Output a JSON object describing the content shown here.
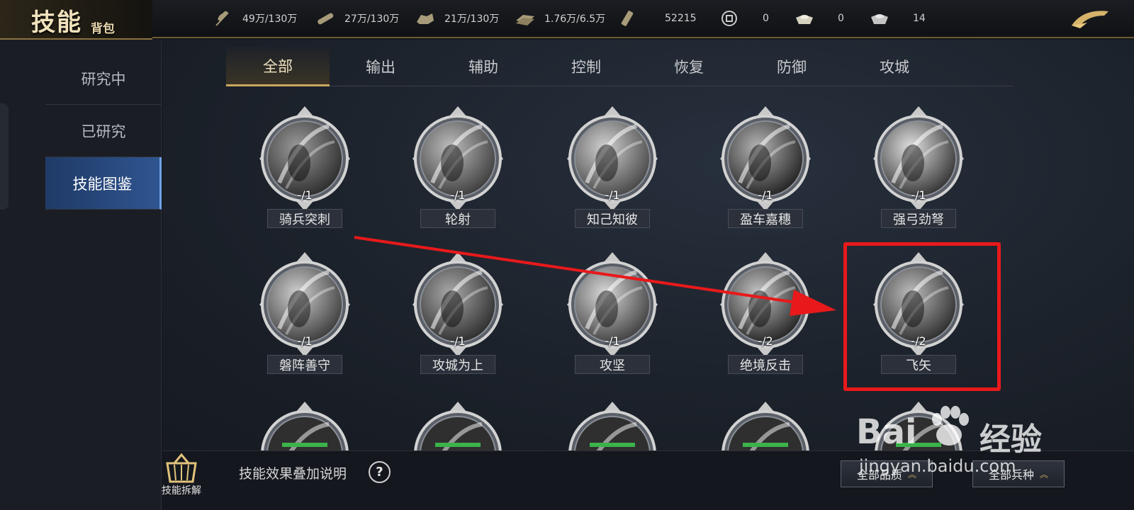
{
  "header": {
    "title_main": "技能",
    "title_sub": "背包",
    "resources": [
      {
        "icon": "grain-icon",
        "value": "49万/130万"
      },
      {
        "icon": "wood-icon",
        "value": "27万/130万"
      },
      {
        "icon": "stone-icon",
        "value": "21万/130万"
      },
      {
        "icon": "iron-icon",
        "value": "1.76万/6.5万"
      },
      {
        "icon": "decree-icon",
        "value": "52215"
      },
      {
        "icon": "copper-coin-icon",
        "value": "0"
      },
      {
        "icon": "gold-ingot-icon",
        "value": "0"
      },
      {
        "icon": "silver-ingot-icon",
        "value": "14"
      }
    ]
  },
  "sidebar": {
    "items": [
      {
        "label": "研究中"
      },
      {
        "label": "已研究"
      },
      {
        "label": "技能图鉴"
      }
    ],
    "active_index": 2
  },
  "tabs": {
    "items": [
      "全部",
      "输出",
      "辅助",
      "控制",
      "恢复",
      "防御",
      "攻城"
    ],
    "active_index": 0
  },
  "skills": [
    {
      "name": "骑兵突刺",
      "count": "-/1"
    },
    {
      "name": "轮射",
      "count": "-/1"
    },
    {
      "name": "知己知彼",
      "count": "-/1"
    },
    {
      "name": "盈车嘉穗",
      "count": "-/1"
    },
    {
      "name": "强弓劲弩",
      "count": "-/1"
    },
    {
      "name": "磐阵善守",
      "count": "-/1"
    },
    {
      "name": "攻城为上",
      "count": "-/1"
    },
    {
      "name": "攻坚",
      "count": "-/1"
    },
    {
      "name": "绝境反击",
      "count": "-/2"
    },
    {
      "name": "飞矢",
      "count": "-/2"
    }
  ],
  "bottom": {
    "dismantle_label": "技能拆解",
    "effect_text": "技能效果叠加说明",
    "help_glyph": "?",
    "filter_quality": "全部品质",
    "filter_troop": "全部兵种"
  },
  "watermark": {
    "brand": "Bai",
    "brand_cn": "经验",
    "url": "jingyan.baidu.com"
  },
  "colors": {
    "highlight": "#e8191b",
    "accent_gold": "#c9a660",
    "active_nav": "#2f5590"
  }
}
